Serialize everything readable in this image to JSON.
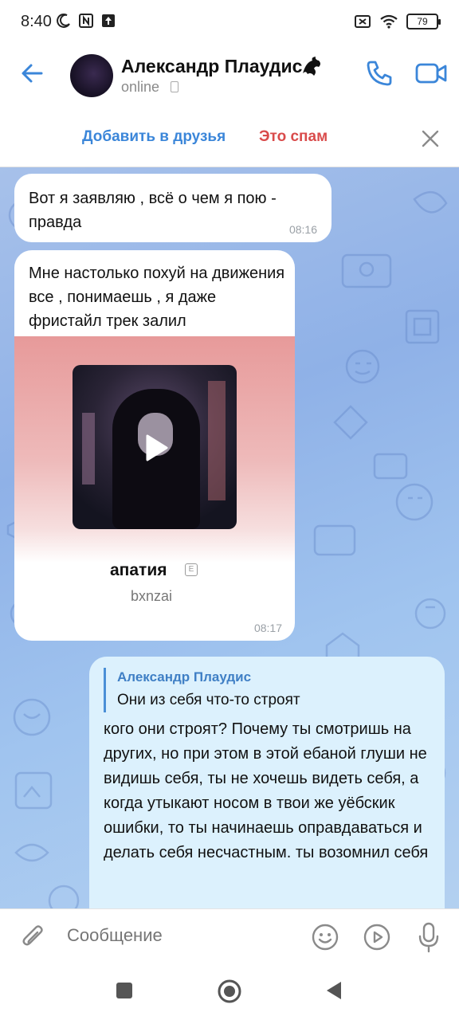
{
  "status_bar": {
    "time": "8:40",
    "battery": "79",
    "icons": [
      "moon-icon",
      "nfc-icon",
      "upload-icon",
      "sim-off-icon",
      "wifi-icon",
      "battery-icon"
    ]
  },
  "header": {
    "name": "Александр Плаудис",
    "status": "online",
    "icons": [
      "back-arrow-icon",
      "dragon-emoji-icon",
      "phone-icon",
      "video-camera-icon"
    ]
  },
  "actions": {
    "add_friend": "Добавить в друзья",
    "spam": "Это спам"
  },
  "messages": [
    {
      "direction": "in",
      "text": "Вот я заявляю , всё о чем я пою - правда",
      "time": "08:16"
    },
    {
      "direction": "in",
      "text": "Мне настолько похуй на движения все , понимаешь , я даже фристайл трек залил",
      "time": "08:17",
      "music": {
        "title": "апатия",
        "explicit_badge": "E",
        "artist": "bxnzai"
      }
    },
    {
      "direction": "out",
      "reply_to": {
        "name": "Александр Плаудис",
        "text": "Они из себя что-то строят"
      },
      "text": "кого они строят? Почему ты смотришь на других, но при этом в этой ебаной глуши не видишь себя, ты не хочешь видеть себя, а когда утыкают носом в твои же уёбскик ошибки, то ты начинаешь оправдаваться и делать себя несчастным. ты возомнил себя"
    }
  ],
  "input": {
    "placeholder": "Сообщение"
  },
  "colors": {
    "accent": "#3b86d9",
    "spam": "#d94b4b",
    "outgoing_bubble": "#dcf1fd",
    "chat_background": "#9cbbe9"
  }
}
